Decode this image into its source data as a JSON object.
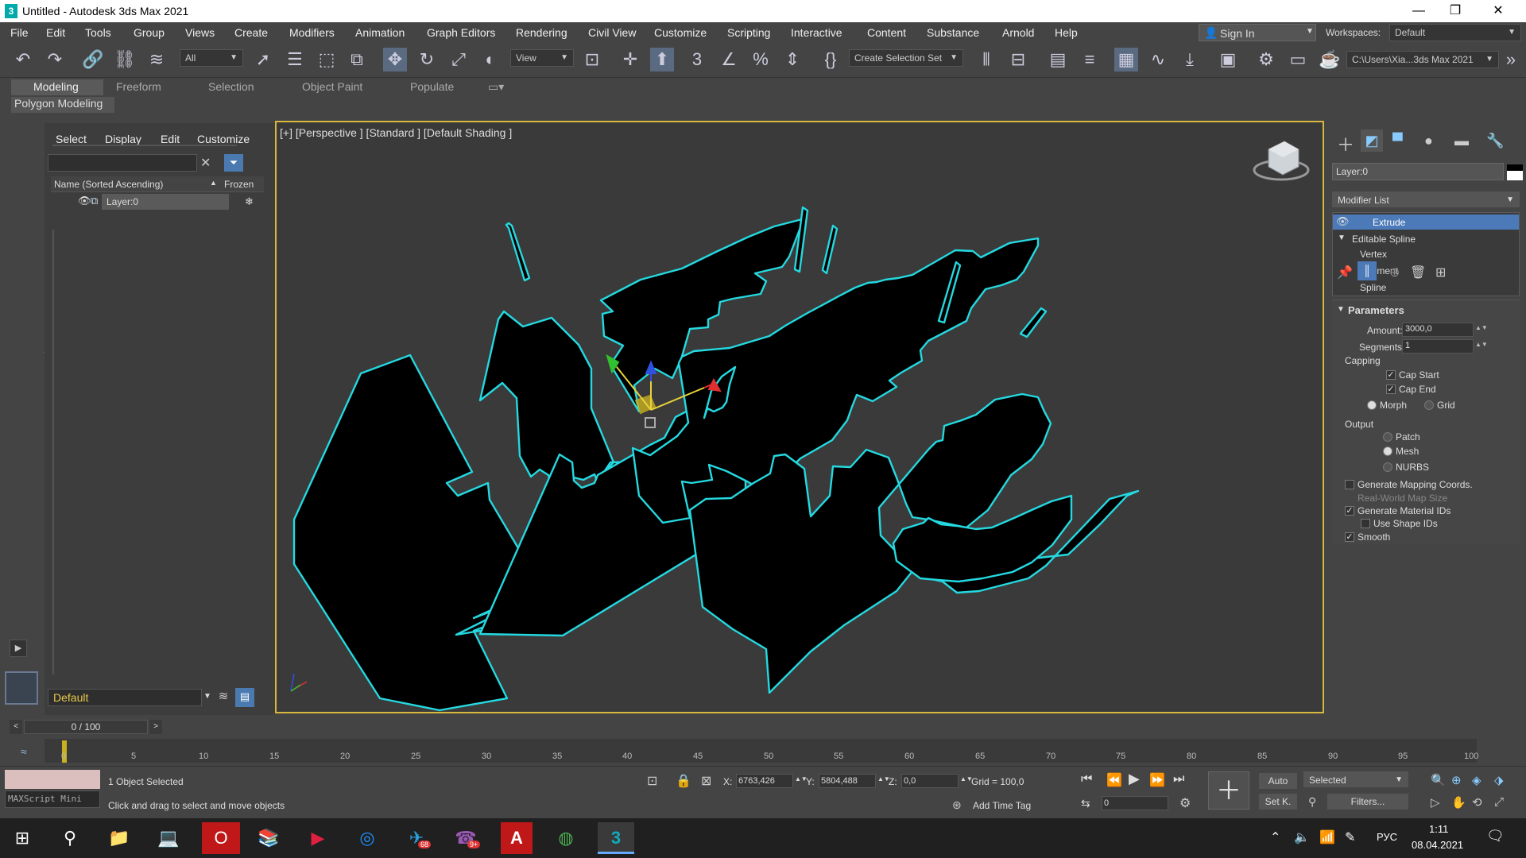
{
  "window": {
    "title": "Untitled - Autodesk 3ds Max 2021",
    "logo": "3",
    "minimize": "—",
    "maximize": "❐",
    "close": "✕"
  },
  "menu": [
    "File",
    "Edit",
    "Tools",
    "Group",
    "Views",
    "Create",
    "Modifiers",
    "Animation",
    "Graph Editors",
    "Rendering",
    "Civil View",
    "Customize",
    "Scripting",
    "Interactive",
    "Content",
    "Substance",
    "Arnold",
    "Help"
  ],
  "signin": "Sign In",
  "workspaces_label": "Workspaces:",
  "workspace": "Default",
  "toolbar": {
    "filter": "All",
    "refcoord": "View",
    "selset": "Create Selection Set",
    "path": "C:\\Users\\Xia...3ds Max 2021"
  },
  "ribbon": [
    "Modeling",
    "Freeform",
    "Selection",
    "Object Paint",
    "Populate"
  ],
  "polygon_modeling": "Polygon Modeling",
  "scene": {
    "tabs": [
      "Select",
      "Display",
      "Edit",
      "Customize"
    ],
    "col_name": "Name (Sorted Ascending)",
    "col_frozen": "Frozen",
    "row": "Layer:0",
    "layer_dropdown": "Default"
  },
  "viewport": {
    "label": "[+] [Perspective ] [Standard ] [Default Shading ]"
  },
  "cmd": {
    "objname": "Layer:0",
    "modlist": "Modifier List",
    "stack": [
      "Extrude",
      "Editable Spline",
      "Vertex",
      "Segment",
      "Spline"
    ],
    "params_title": "Parameters",
    "amount_label": "Amount:",
    "amount": "3000,0",
    "segments_label": "Segments:",
    "segments": "1",
    "capping": "Capping",
    "cap_start": "Cap Start",
    "cap_end": "Cap End",
    "morph": "Morph",
    "grid": "Grid",
    "output": "Output",
    "patch": "Patch",
    "mesh": "Mesh",
    "nurbs": "NURBS",
    "gen_map": "Generate Mapping Coords.",
    "real_world": "Real-World Map Size",
    "gen_mat": "Generate Material IDs",
    "use_shape": "Use Shape IDs",
    "smooth": "Smooth"
  },
  "timeline": {
    "frame": "0 / 100",
    "ticks": [
      "0",
      "5",
      "10",
      "15",
      "20",
      "25",
      "30",
      "35",
      "40",
      "45",
      "50",
      "55",
      "60",
      "65",
      "70",
      "75",
      "80",
      "85",
      "90",
      "95",
      "100"
    ]
  },
  "status": {
    "script": "MAXScript Mini",
    "selected": "1 Object Selected",
    "prompt": "Click and drag to select and move objects",
    "x_label": "X:",
    "x": "6763,426",
    "y_label": "Y:",
    "y": "5804,488",
    "z_label": "Z:",
    "z": "0,0",
    "grid": "Grid = 100,0",
    "add_time_tag": "Add Time Tag",
    "auto": "Auto",
    "setk": "Set K.",
    "selected_dd": "Selected",
    "filters": "Filters...",
    "frame_input": "0"
  },
  "taskbar": {
    "lang": "РУС",
    "time": "1:11",
    "date": "08.04.2021",
    "badge1": "68",
    "badge2": "9+"
  }
}
